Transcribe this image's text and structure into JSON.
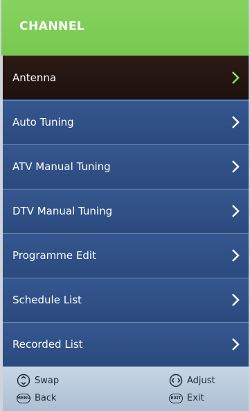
{
  "header": {
    "title": "CHANNEL"
  },
  "menu": {
    "items": [
      {
        "label": "Antenna"
      },
      {
        "label": "Auto Tuning"
      },
      {
        "label": "ATV Manual Tuning"
      },
      {
        "label": "DTV Manual Tuning"
      },
      {
        "label": "Programme Edit"
      },
      {
        "label": "Schedule List"
      },
      {
        "label": "Recorded List"
      }
    ]
  },
  "footer": {
    "swap": "Swap",
    "adjust": "Adjust",
    "back": "Back",
    "exit": "Exit",
    "back_icon_text": "MENU",
    "exit_icon_text": "EXIT"
  },
  "colors": {
    "header": "#7fcf57",
    "menu_bg": "#2d4f86",
    "selected_bg": "#22140f",
    "chevron_default": "#ffffff",
    "chevron_selected": "#8fe26a"
  }
}
